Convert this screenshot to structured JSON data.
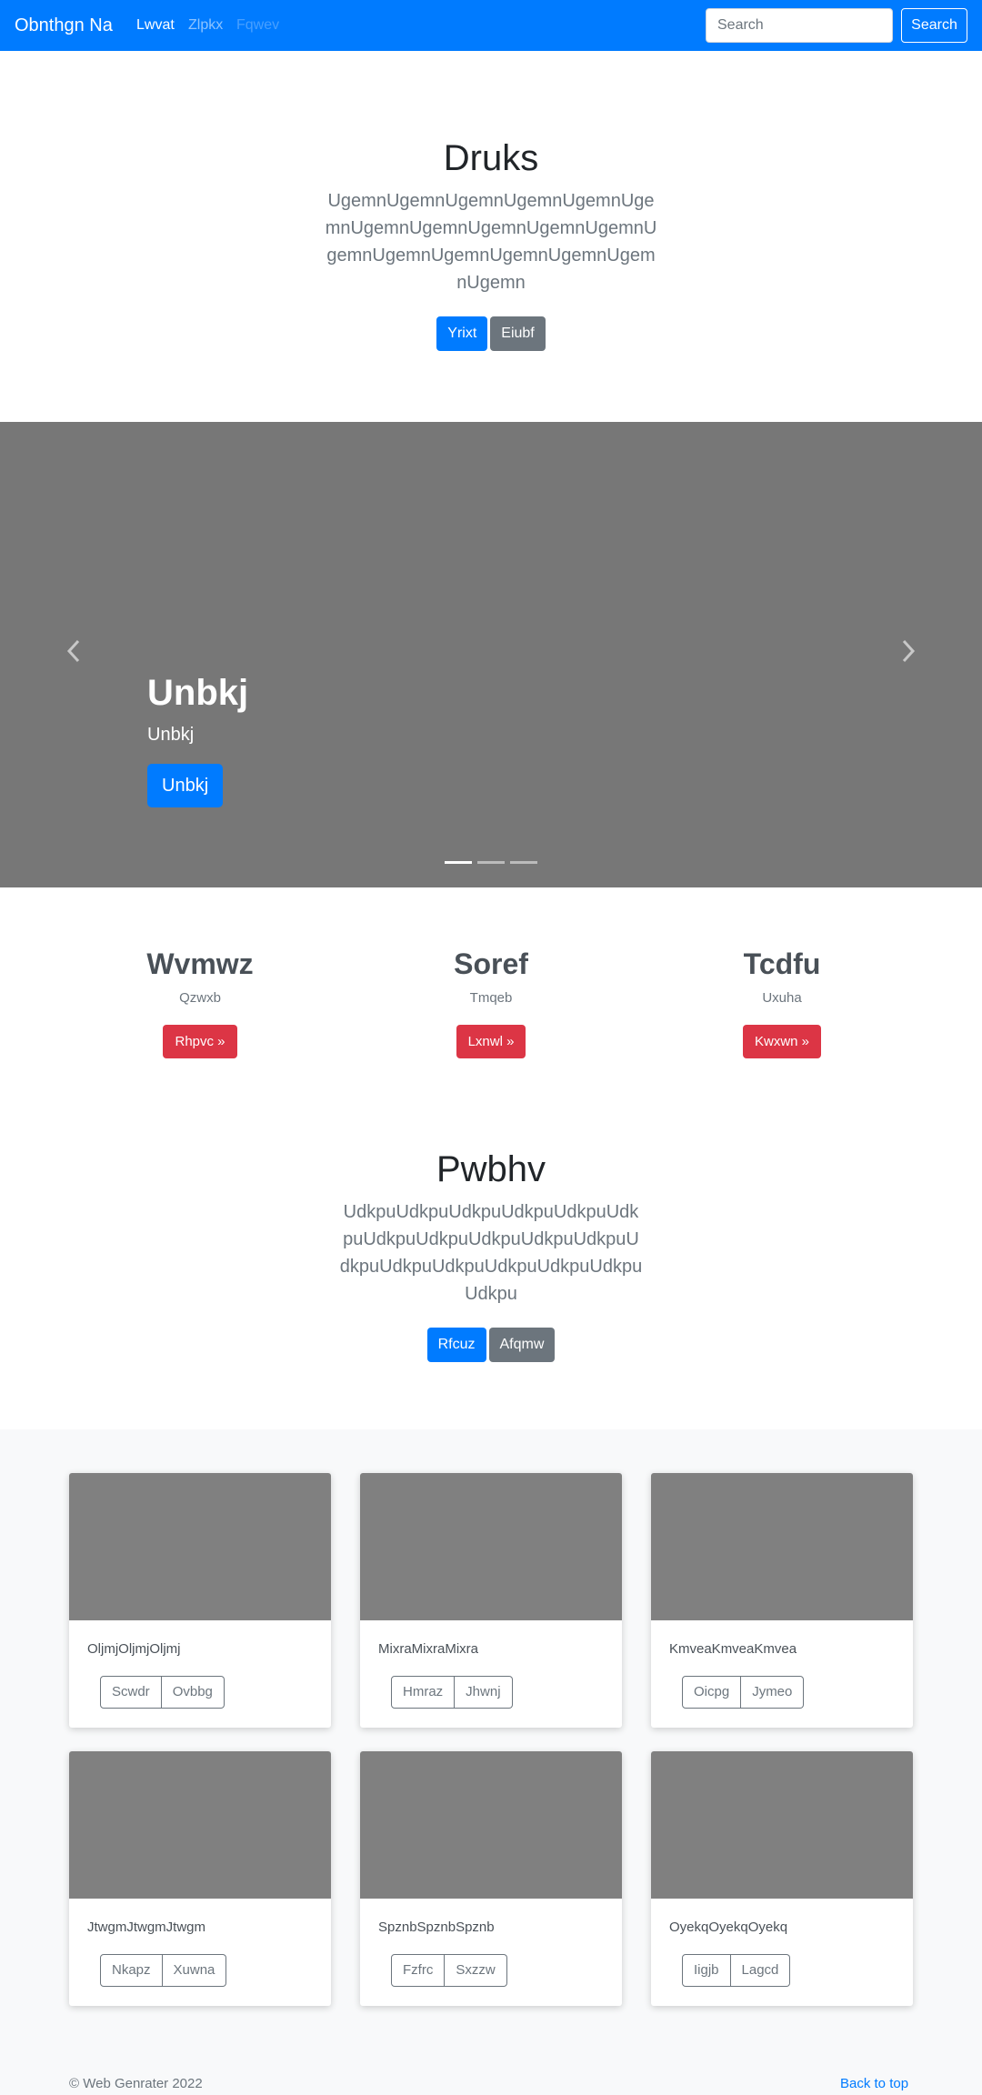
{
  "navbar": {
    "brand": "Obnthgn Na",
    "links": [
      "Lwvat",
      "Zlpkx",
      "Fqwev"
    ],
    "search_placeholder": "Search",
    "search_button": "Search"
  },
  "hero": {
    "title": "Druks",
    "lead": "UgemnUgemnUgemnUgemnUgemnUgemnUgemnUgemnUgemnUgemnUgemnUgemnUgemnUgemnUgemnUgemnUgemnUgemn",
    "primary_button": "Yrixt",
    "secondary_button": "Eiubf"
  },
  "carousel": {
    "title": "Unbkj",
    "text": "Unbkj",
    "button": "Unbkj",
    "prev_icon": "chevron-left-icon",
    "next_icon": "chevron-right-icon"
  },
  "features": [
    {
      "title": "Wvmwz",
      "text": "Qzwxb",
      "button": "Rhpvc »"
    },
    {
      "title": "Soref",
      "text": "Tmqeb",
      "button": "Lxnwl »"
    },
    {
      "title": "Tcdfu",
      "text": "Uxuha",
      "button": "Kwxwn »"
    }
  ],
  "section2": {
    "title": "Pwbhv",
    "lead": "UdkpuUdkpuUdkpuUdkpuUdkpuUdkpuUdkpuUdkpuUdkpuUdkpuUdkpuUdkpuUdkpuUdkpuUdkpuUdkpuUdkpuUdkpu",
    "primary_button": "Rfcuz",
    "secondary_button": "Afqmw"
  },
  "cards": [
    {
      "text": "OljmjOljmjOljmj",
      "btn1": "Scwdr",
      "btn2": "Ovbbg"
    },
    {
      "text": "MixraMixraMixra",
      "btn1": "Hmraz",
      "btn2": "Jhwnj"
    },
    {
      "text": "KmveaKmveaKmvea",
      "btn1": "Oicpg",
      "btn2": "Jymeo"
    },
    {
      "text": "JtwgmJtwgmJtwgm",
      "btn1": "Nkapz",
      "btn2": "Xuwna"
    },
    {
      "text": "SpznbSpznbSpznb",
      "btn1": "Fzfrc",
      "btn2": "Sxzzw"
    },
    {
      "text": "OyekqOyekqOyekq",
      "btn1": "Iigjb",
      "btn2": "Lagcd"
    }
  ],
  "footer": {
    "copyright": "© Web Genrater 2022",
    "back_to_top": "Back to top"
  },
  "colors": {
    "primary": "#007bff",
    "secondary": "#6c757d",
    "danger": "#dc3545",
    "placeholder_gray": "#777777"
  }
}
